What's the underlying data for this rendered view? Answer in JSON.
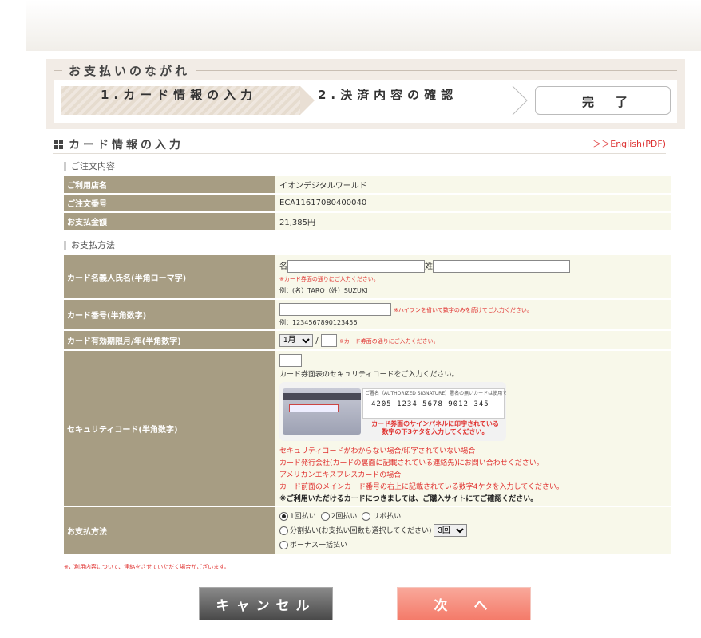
{
  "flow": {
    "title": "お支払いのながれ",
    "step1": "1.カード情報の入力",
    "step2": "2.決済内容の確認",
    "step3": "完　了"
  },
  "section": {
    "title": "カード情報の入力",
    "english_link": "＞＞English(PDF)"
  },
  "order": {
    "heading": "ご注文内容",
    "rows": [
      {
        "label": "ご利用店名",
        "value": "イオンデジタルワールド"
      },
      {
        "label": "ご注文番号",
        "value": "ECA11617080400040"
      },
      {
        "label": "お支払金額",
        "value": "21,385円"
      }
    ]
  },
  "payment": {
    "heading": "お支払方法",
    "name_label": "カード名義人氏名(半角ローマ字)",
    "first_name_prefix": "名",
    "last_name_prefix": "姓",
    "name_note": "※カード券面の通りにご入力ください。",
    "name_example": "例：(名）TARO（姓）SUZUKI",
    "card_number_label": "カード番号(半角数字)",
    "card_number_note": "※ハイフンを省いて数字のみを続けてご入力ください。",
    "card_number_example": "例：1234567890123456",
    "expiry_label": "カード有効期限月/年(半角数字)",
    "expiry_month": "1月",
    "expiry_sep": "/",
    "expiry_note": "※カード券面の通りにご入力ください。",
    "security_label": "セキュリティコード(半角数字)",
    "security_instruction": "カード券面表のセキュリティコードをご入力ください。",
    "card_image_caption_top": "ご署名（AUTHORIZED SIGNATURE）署名の無いカードは使用できません。",
    "card_image_numbers": "4205 1234 5678 9012 345",
    "card_image_caption_bottom_1": "カード券面のサインパネルに印字されている",
    "card_image_caption_bottom_2": "数字の下3ケタを入力してください。",
    "security_help": [
      "セキュリティコードがわからない場合/印字されていない場合",
      "カード発行会社(カードの裏面に記載されている連絡先)にお問い合わせください。",
      "アメリカンエキスプレスカードの場合",
      "カード前面のメインカード番号の右上に記載されている数字4ケタを入力してください。"
    ],
    "security_bold": "※ご利用いただけるカードにつきましては、ご購入サイトにてご確認ください。",
    "method_label": "お支払方法",
    "method_lump": "1回払い",
    "method_two": "2回払い",
    "method_revo": "リボ払い",
    "method_installment": "分割払い(お支払い回数も選択してください)",
    "installment_count": "3回",
    "method_bonus": "ボーナス一括払い"
  },
  "footnote": "※ご利用内容について、連絡をさせていただく場合がございます。",
  "buttons": {
    "cancel": "キャンセル",
    "next": "次　へ"
  },
  "colors": {
    "header_cell": "#a79d83",
    "value_cell": "#f8f8ea",
    "alert": "#e0312f",
    "next_button": "#f47b6a",
    "cancel_button": "#4a4a4a"
  }
}
